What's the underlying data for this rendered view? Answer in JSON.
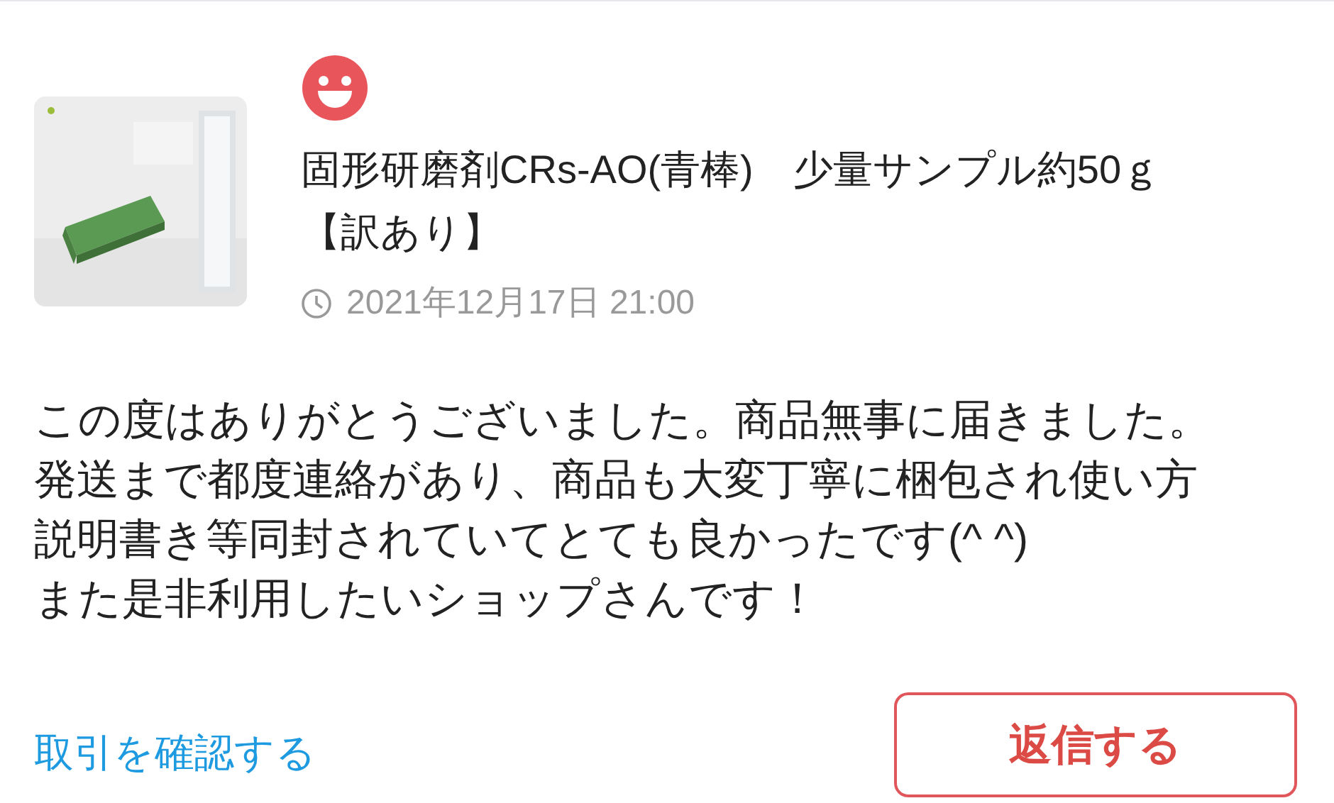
{
  "review": {
    "item_title": "固形研磨剤CRs-AO(青棒)　少量サンプル約50ｇ【訳あり】",
    "date": "2021年12月17日 21:00",
    "comment_lines": [
      "この度はありがとうございました。商品無事に届きました。",
      "発送まで都度連絡があり、商品も大変丁寧に梱包され使い方",
      "説明書き等同封されていてとても良かったです(^ ^)",
      "また是非利用したいショップさんです！"
    ]
  },
  "actions": {
    "link": "取引を確認する",
    "button": "返信する"
  }
}
